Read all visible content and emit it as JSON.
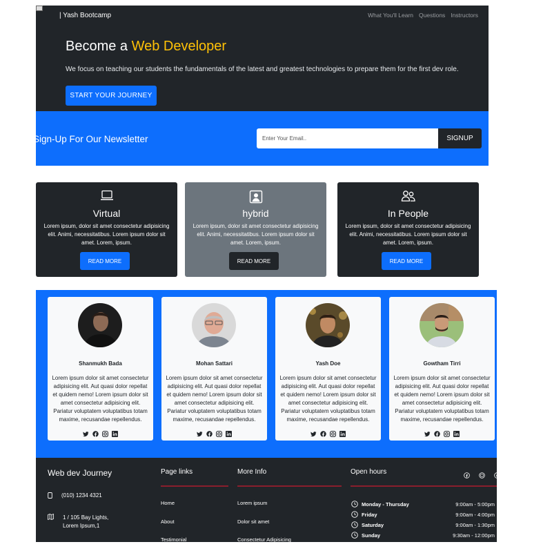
{
  "nav": {
    "brand": "| Yash Bootcamp",
    "links": [
      "What You'll Learn",
      "Questions",
      "Instructors"
    ]
  },
  "hero": {
    "title_prefix": "Become a ",
    "title_accent": "Web Developer",
    "subtitle": "We focus on teaching our students the fundamentals of the latest and greatest technologies to prepare them for the first dev role.",
    "cta": "START YOUR JOURNEY"
  },
  "newsletter": {
    "heading": "Sign-Up For Our Newsletter",
    "placeholder": "Enter Your Email..",
    "button": "SIGNUP"
  },
  "boxes": [
    {
      "icon": "laptop-icon",
      "title": "Virtual",
      "text": "Lorem ipsum, dolor sit amet consectetur adipisicing elit. Animi, necessitatibus. Lorem ipsum dolor sit amet. Lorem, ipsum.",
      "button": "READ MORE"
    },
    {
      "icon": "person-square-icon",
      "title": "hybrid",
      "text": "Lorem ipsum, dolor sit amet consectetur adipisicing elit. Animi, necessitatibus. Lorem ipsum dolor sit amet. Lorem, ipsum.",
      "button": "READ MORE"
    },
    {
      "icon": "people-icon",
      "title": "In People",
      "text": "Lorem ipsum, dolor sit amet consectetur adipisicing elit. Animi, necessitatibus. Lorem ipsum dolor sit amet. Lorem, ipsum.",
      "button": "READ MORE"
    }
  ],
  "instructors": [
    {
      "name": "Shanmukh Bada",
      "bio": "Lorem ipsum dolor sit amet consectetur adipisicing elit. Aut quasi dolor repellat et quidem nemo! Lorem ipsum dolor sit amet consectetur adipisicing elit. Pariatur voluptatem voluptatibus totam maxime, recusandae repellendus."
    },
    {
      "name": "Mohan Sattari",
      "bio": "Lorem ipsum dolor sit amet consectetur adipisicing elit. Aut quasi dolor repellat et quidem nemo! Lorem ipsum dolor sit amet consectetur adipisicing elit. Pariatur voluptatem voluptatibus totam maxime, recusandae repellendus."
    },
    {
      "name": "Yash Doe",
      "bio": "Lorem ipsum dolor sit amet consectetur adipisicing elit. Aut quasi dolor repellat et quidem nemo! Lorem ipsum dolor sit amet consectetur adipisicing elit. Pariatur voluptatem voluptatibus totam maxime, recusandae repellendus."
    },
    {
      "name": "Gowtham Tirri",
      "bio": "Lorem ipsum dolor sit amet consectetur adipisicing elit. Aut quasi dolor repellat et quidem nemo! Lorem ipsum dolor sit amet consectetur adipisicing elit. Pariatur voluptatem voluptatibus totam maxime, recusandae repellendus."
    }
  ],
  "footer": {
    "title": "Web dev Journey",
    "phone": "(010) 1234 4321",
    "address_line1": "1 / 105 Bay Lights,",
    "address_line2": "Lorem Ipsum,1",
    "page_links_title": "Page links",
    "page_links": [
      "Home",
      "About",
      "Testimonial"
    ],
    "more_info_title": "More Info",
    "more_info": [
      "Lorem ipsum",
      "Dolor sit amet",
      "Consectetur Adipisicing"
    ],
    "hours_title": "Open hours",
    "hours": [
      {
        "day": "Monday - Thursday",
        "time": "9:00am - 5:00pm"
      },
      {
        "day": "Friday",
        "time": "9:00am - 4:00pm"
      },
      {
        "day": "Saturday",
        "time": "9:00am - 1:30pm"
      },
      {
        "day": "Sunday",
        "time": "9:30am - 12:00pm"
      }
    ]
  },
  "colors": {
    "dark": "#212529",
    "primary": "#0d6efd",
    "accent": "#ffc107",
    "grey": "#6c757d",
    "footer_rule": "#8b1e2c"
  }
}
